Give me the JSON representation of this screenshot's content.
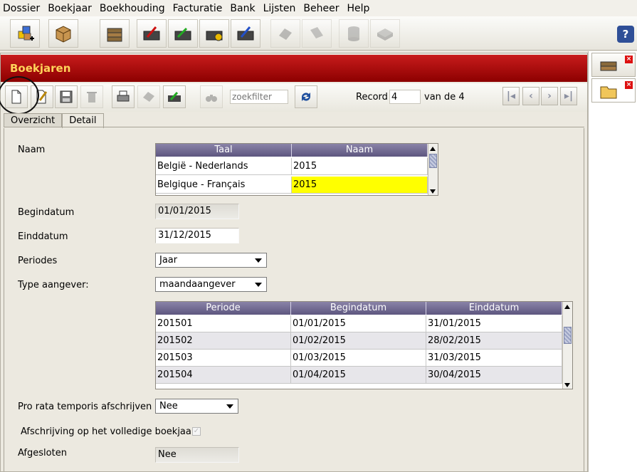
{
  "menu": {
    "items": [
      "Dossier",
      "Boekjaar",
      "Boekhouding",
      "Facturatie",
      "Bank",
      "Lijsten",
      "Beheer",
      "Help"
    ]
  },
  "toolbar": {
    "help_label": "?"
  },
  "window": {
    "title": "Boekjaren"
  },
  "subtoolbar": {
    "search_placeholder": "zoekfilter",
    "record_label": "Record",
    "record_value": "4",
    "record_of": "van de 4"
  },
  "tabs": [
    "Overzicht",
    "Detail"
  ],
  "form": {
    "naam_label": "Naam",
    "naam_grid": {
      "headers": [
        "Taal",
        "Naam"
      ],
      "rows": [
        [
          "België - Nederlands",
          "2015"
        ],
        [
          "Belgique - Français",
          "2015"
        ]
      ]
    },
    "begindatum_label": "Begindatum",
    "begindatum_value": "01/01/2015",
    "einddatum_label": "Einddatum",
    "einddatum_value": "31/12/2015",
    "periodes_label": "Periodes",
    "periodes_value": "Jaar",
    "type_aangever_label": "Type aangever:",
    "type_aangever_value": "maandaangever",
    "periode_grid": {
      "headers": [
        "Periode",
        "Begindatum",
        "Einddatum"
      ],
      "rows": [
        [
          "201501",
          "01/01/2015",
          "31/01/2015"
        ],
        [
          "201502",
          "01/02/2015",
          "28/02/2015"
        ],
        [
          "201503",
          "01/03/2015",
          "31/03/2015"
        ],
        [
          "201504",
          "01/04/2015",
          "30/04/2015"
        ]
      ]
    },
    "pro_rata_label": "Pro rata temporis afschrijven",
    "pro_rata_value": "Nee",
    "volledige_label": "Afschrijving op het volledige boekjaar",
    "afgesloten_label": "Afgesloten",
    "afgesloten_value": "Nee"
  },
  "colors": {
    "title_bar": "#b00000",
    "title_text": "#ffd35a",
    "grid_header": "#6b6490",
    "highlight": "#ffff00"
  }
}
